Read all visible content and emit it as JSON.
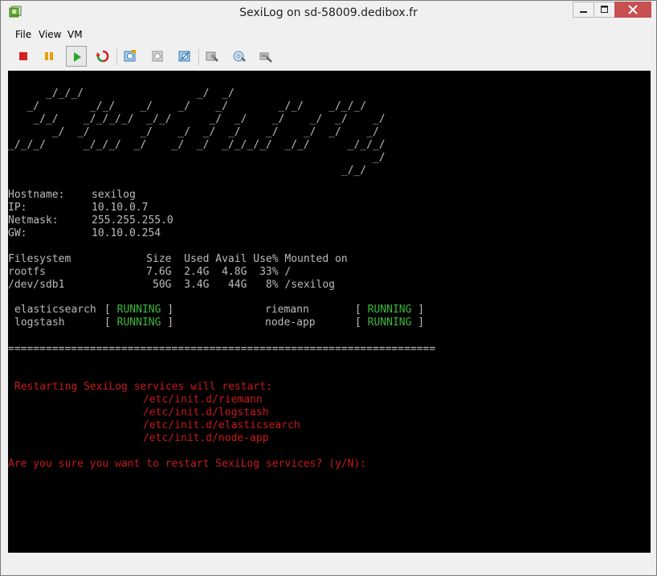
{
  "window": {
    "title": "SexiLog on sd-58009.dedibox.fr"
  },
  "menu": [
    "File",
    "View",
    "VM"
  ],
  "toolbar": {
    "buttons": [
      {
        "icon": "stop-icon"
      },
      {
        "icon": "pause-icon"
      },
      {
        "icon": "play-icon"
      },
      {
        "icon": "reset-icon"
      },
      {
        "icon": "snapshot-icon"
      },
      {
        "icon": "revert-snapshot-icon"
      },
      {
        "icon": "snapshot-manager-icon"
      },
      {
        "icon": "vm-settings-icon"
      },
      {
        "icon": "cd-dvd-icon"
      },
      {
        "icon": "network-settings-icon"
      }
    ]
  },
  "console": {
    "banner": [
      "      _/_/_/                  _/  _/",
      "   _/        _/_/    _/    _/    _/        _/_/    _/_/_/",
      "    _/_/    _/_/_/_/  _/_/      _/  _/    _/    _/  _/    _/",
      "       _/  _/        _/    _/  _/  _/    _/    _/  _/    _/",
      "_/_/_/      _/_/_/  _/    _/  _/  _/_/_/_/  _/_/      _/_/_/",
      "                                                          _/",
      "                                                     _/_/"
    ],
    "network": [
      {
        "label": "Hostname:",
        "value": "sexilog"
      },
      {
        "label": "IP:",
        "value": "10.10.0.7"
      },
      {
        "label": "Netmask:",
        "value": "255.255.255.0"
      },
      {
        "label": "GW:",
        "value": "10.10.0.254"
      }
    ],
    "df_header": "Filesystem            Size  Used Avail Use% Mounted on",
    "df_rows": [
      "rootfs                7.6G  2.4G  4.8G  33% /",
      "/dev/sdb1              50G  3.4G   44G   8% /sexilog"
    ],
    "services": [
      {
        "name": "elasticsearch",
        "status": "RUNNING"
      },
      {
        "name": "riemann",
        "status": "RUNNING"
      },
      {
        "name": "logstash",
        "status": "RUNNING"
      },
      {
        "name": "node-app",
        "status": "RUNNING"
      }
    ],
    "separator": "====================================================================",
    "restart_heading": "Restarting SexiLog services will restart:",
    "restart_items": [
      "/etc/init.d/riemann",
      "/etc/init.d/logstash",
      "/etc/init.d/elasticsearch",
      "/etc/init.d/node-app"
    ],
    "prompt": "Are you sure you want to restart SexiLog services? (y/N):"
  },
  "colors": {
    "terminal_bg": "#000000",
    "terminal_fg": "#bbbbbb",
    "warning_red": "#c8181a",
    "running_green": "#3ab93a"
  }
}
